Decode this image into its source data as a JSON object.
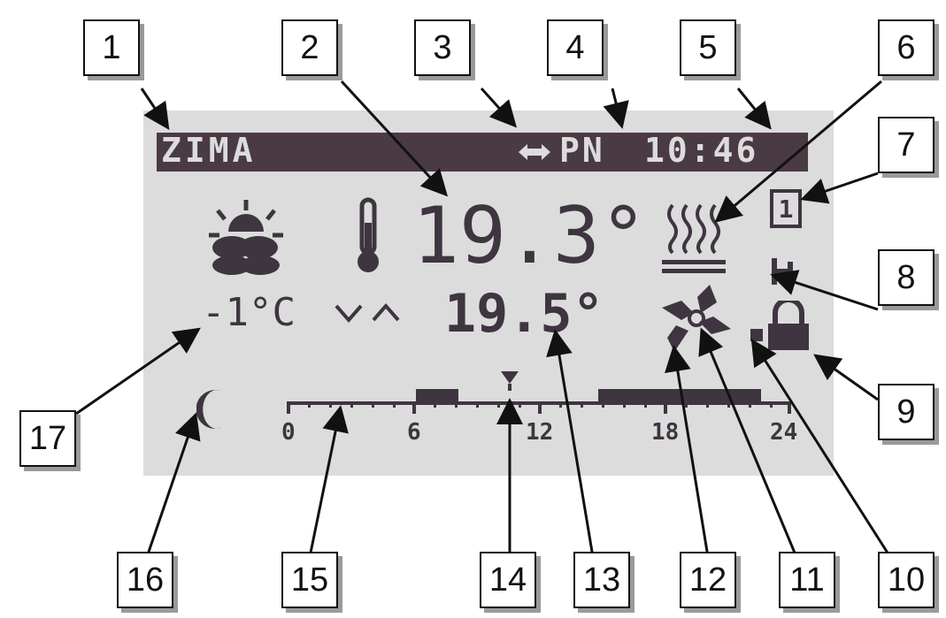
{
  "display": {
    "season": "ZIMA",
    "day": "PN",
    "time": "10:46",
    "room_temp": "19.3°",
    "set_temp": "19.5°",
    "outdoor_temp": "-1°C",
    "zone_number": "1",
    "timeline_ticks": [
      "0",
      "6",
      "12",
      "18",
      "24"
    ]
  },
  "callouts": [
    "1",
    "2",
    "3",
    "4",
    "5",
    "6",
    "7",
    "8",
    "9",
    "10",
    "11",
    "12",
    "13",
    "14",
    "15",
    "16",
    "17"
  ],
  "colors": {
    "lcd_background": "#dcdcdc",
    "pixel_dark": "#3e3540",
    "header_bar": "#4a3a44"
  }
}
